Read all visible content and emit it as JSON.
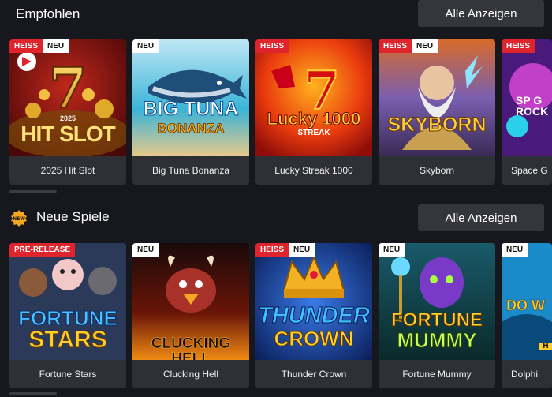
{
  "sections": [
    {
      "title": "Empfohlen",
      "button_label": "Alle Anzeigen",
      "games": [
        {
          "name": "2025 Hit Slot",
          "badges": [
            "HEISS",
            "NEU"
          ],
          "art_text": "HIT SLOT",
          "art_sub": "2025"
        },
        {
          "name": "Big Tuna Bonanza",
          "badges": [
            "NEU"
          ],
          "art_text": "BIG TUNA",
          "art_sub": "BONANZA"
        },
        {
          "name": "Lucky Streak 1000",
          "badges": [
            "HEISS"
          ],
          "art_text": "Lucky 1000",
          "art_sub": "STREAK"
        },
        {
          "name": "Skyborn",
          "badges": [
            "HEISS",
            "NEU"
          ],
          "art_text": "SKYBORN",
          "art_sub": ""
        },
        {
          "name": "Space G",
          "badges": [
            "HEISS"
          ],
          "art_text": "SP G ROCK",
          "art_sub": ""
        }
      ]
    },
    {
      "title": "Neue Spiele",
      "icon_label": "NEW",
      "button_label": "Alle Anzeigen",
      "games": [
        {
          "name": "Fortune Stars",
          "badges": [
            "PRE-RELEASE"
          ],
          "art_text": "FORTUNE",
          "art_sub": "STARS"
        },
        {
          "name": "Clucking Hell",
          "badges": [
            "NEU"
          ],
          "art_text": "CLUCKING HELL",
          "art_sub": ""
        },
        {
          "name": "Thunder Crown",
          "badges": [
            "HEISS",
            "NEU"
          ],
          "art_text": "THUNDER",
          "art_sub": "CROWN"
        },
        {
          "name": "Fortune Mummy",
          "badges": [
            "NEU"
          ],
          "art_text": "FORTUNE",
          "art_sub": "MUMMY"
        },
        {
          "name": "Dolphi",
          "badges": [
            "NEU"
          ],
          "art_text": "DO W",
          "art_sub": "H"
        }
      ]
    }
  ],
  "colors": {
    "background": "#16181d",
    "button": "#34363c",
    "caption": "#2e3036",
    "hot_badge": "#e0242e",
    "new_badge": "#ffffff"
  }
}
